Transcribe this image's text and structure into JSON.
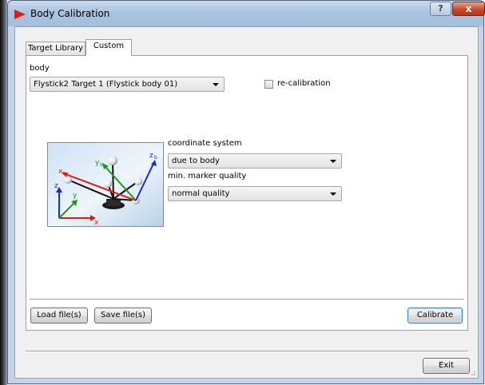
{
  "window": {
    "title": "Body Calibration",
    "help_label": "?",
    "close_label": "x"
  },
  "tabs": [
    {
      "label": "Target Library",
      "active": false
    },
    {
      "label": "Custom",
      "active": true
    }
  ],
  "form": {
    "body_label": "body",
    "body_value": "Flystick2 Target 1 (Flystick body 01)",
    "recalibration_label": "re-calibration",
    "recalibration_checked": false,
    "coordinate_system_label": "coordinate system",
    "coordinate_system_value": "due to body",
    "min_quality_label": "min. marker quality",
    "min_quality_value": "normal quality"
  },
  "preview": {
    "axis_labels": {
      "xb": "x",
      "yb": "y",
      "zb": "z",
      "sub_b": "b",
      "z": "z",
      "y": "y",
      "x": "x"
    }
  },
  "buttons": {
    "load": "Load file(s)",
    "save": "Save file(s)",
    "calibrate": "Calibrate",
    "exit": "Exit"
  },
  "colors": {
    "accent_red": "#d4201a",
    "axis_green": "#1a9a1a",
    "axis_blue": "#1a2ad0"
  }
}
